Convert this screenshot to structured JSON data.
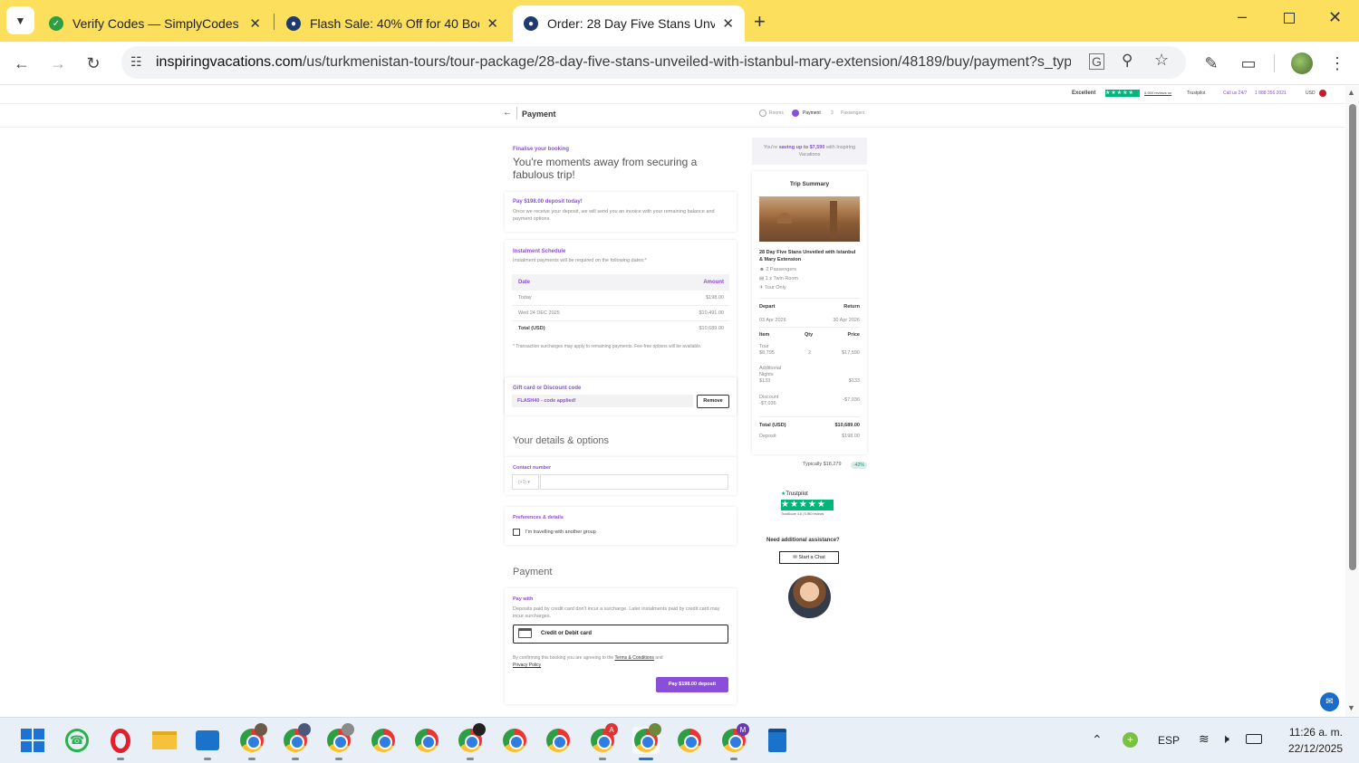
{
  "browser": {
    "tabs": [
      {
        "title": "Verify Codes — SimplyCodes",
        "active": false,
        "favicon_color": "#2e9e44"
      },
      {
        "title": "Flash Sale: 40% Off for 40 Book",
        "active": false,
        "favicon_color": "#1f3a6e"
      },
      {
        "title": "Order: 28 Day Five Stans Unveil",
        "active": true,
        "favicon_color": "#1f3a6e"
      }
    ],
    "url_domain": "inspiringvacations.com",
    "url_path": "/us/turkmenistan-tours/tour-package/28-day-five-stans-unveiled-with-istanbul-mary-extension/48189/buy/payment?s_type..."
  },
  "topstrip": {
    "excellent": "Excellent",
    "reviews": "5,950 reviews on",
    "trustpilot": "Trustpilot",
    "call": "Call us 24/7",
    "phone": "1 888 356 2021",
    "currency": "USD"
  },
  "header": {
    "title": "Payment",
    "steps": [
      "Rooms",
      "Payment",
      "Passengers"
    ],
    "step3_num": "3"
  },
  "intro": {
    "kicker": "Finalise your booking",
    "heading": "You're moments away from securing a fabulous trip!"
  },
  "deposit": {
    "title": "Pay $198.00 deposit today!",
    "text": "Once we receive your deposit, we will send you an invoice with your remaining balance and payment options."
  },
  "instalments": {
    "title": "Instalment Schedule",
    "subtitle": "Instalment payments will be required on the following dates:*",
    "col_date": "Date",
    "col_amount": "Amount",
    "rows": [
      {
        "date": "Today",
        "amount": "$198.00"
      },
      {
        "date": "Wed 24 DEC 2025",
        "amount": "$10,491.00"
      },
      {
        "date": "Total (USD)",
        "amount": "$10,689.00"
      }
    ],
    "note": "* Transaction surcharges may apply to remaining payments. Fee-free options will be available."
  },
  "gift": {
    "title": "Gift card or Discount code",
    "applied": "FLASH40 - code applied!",
    "remove": "Remove"
  },
  "details": {
    "heading": "Your details & options",
    "contact_label": "Contact number",
    "country_code": "(+1)",
    "phone_value": "",
    "prefs_title": "Preferences & details",
    "group_checkbox": "I'm travelling with another group"
  },
  "payment": {
    "heading": "Payment",
    "pay_with": "Pay with",
    "note": "Deposits paid by credit card don't incur a surcharge. Later instalments paid by credit card may incur surcharges.",
    "method": "Credit or Debit card",
    "terms_prefix": "By confirming this booking you are agreeing to the",
    "terms_link": "Terms & Conditions",
    "and": "and",
    "privacy_link": "Privacy Policy",
    "pay_button": "Pay $198.00 deposit"
  },
  "sidebar": {
    "saving_prefix": "You're",
    "saving_bold": "saving up to $7,590",
    "saving_suffix": "with Inspiring Vacations",
    "summary_title": "Trip Summary",
    "trip_name": "28 Day Five Stans Unveiled with Istanbul & Mary Extension",
    "passengers": "2 Passengers",
    "room": "1 x Twin Room",
    "tour_only": "Tour Only",
    "depart_label": "Depart",
    "return_label": "Return",
    "depart_date": "03 Apr 2026",
    "return_date": "30 Apr 2026",
    "col_item": "Item",
    "col_qty": "Qty",
    "col_price": "Price",
    "lines": [
      {
        "item": "Tour",
        "sub": "$8,795",
        "qty": "2",
        "price": "$17,590"
      },
      {
        "item": "Additional Nights",
        "sub": "$133",
        "qty": "",
        "price": "$133"
      },
      {
        "item": "Discount",
        "sub": "-$7,036",
        "qty": "",
        "price": "-$7,036"
      }
    ],
    "total_label": "Total (USD)",
    "total_value": "$10,689.00",
    "deposit_label": "Deposit",
    "deposit_value": "$198.00",
    "typically": "Typically $18,279",
    "badge": "-42%",
    "tp_name": "Trustpilot",
    "tp_score": "TrustScore 4.6 | 5,950 reviews",
    "assist": "Need additional assistance?",
    "chat": "Start a Chat"
  },
  "taskbar": {
    "lang": "ESP",
    "time": "11:26 a. m.",
    "date": "22/12/2025"
  },
  "colors": {
    "tabbar": "#fcdf5c",
    "purple": "#8a4fd9",
    "trustpilot_green": "#00b67a"
  }
}
